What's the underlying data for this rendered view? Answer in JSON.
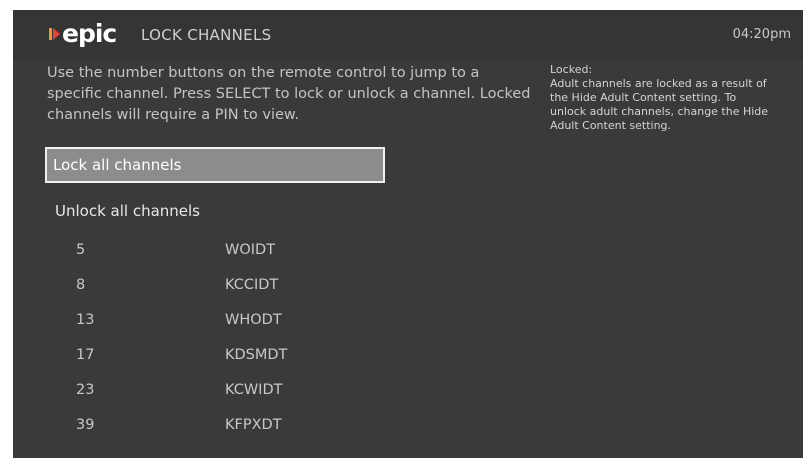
{
  "app": {
    "logo_text": "epic",
    "title": "LOCK CHANNELS",
    "time": "04:20pm"
  },
  "instructions": "Use the number buttons on the remote control to jump to a specific channel. Press SELECT to lock or unlock a channel. Locked channels will require a PIN to view.",
  "info": {
    "title": "Locked:",
    "body": "Adult channels are locked as a result of the Hide Adult Content setting. To unlock adult channels, change the Hide Adult Content setting."
  },
  "actions": {
    "lock_all_label": "Lock all channels",
    "unlock_all_label": "Unlock all channels"
  },
  "channels": [
    {
      "number": "5",
      "name": "WOIDT"
    },
    {
      "number": "8",
      "name": "KCCIDT"
    },
    {
      "number": "13",
      "name": "WHODT"
    },
    {
      "number": "17",
      "name": "KDSMDT"
    },
    {
      "number": "23",
      "name": "KCWIDT"
    },
    {
      "number": "39",
      "name": "KFPXDT"
    }
  ],
  "colors": {
    "background": "#3a3a3a",
    "header": "#353535",
    "selected_button": "#8c8c8c",
    "logo_arrow_orange": "#f29a2e",
    "logo_arrow_red": "#e8413c"
  }
}
